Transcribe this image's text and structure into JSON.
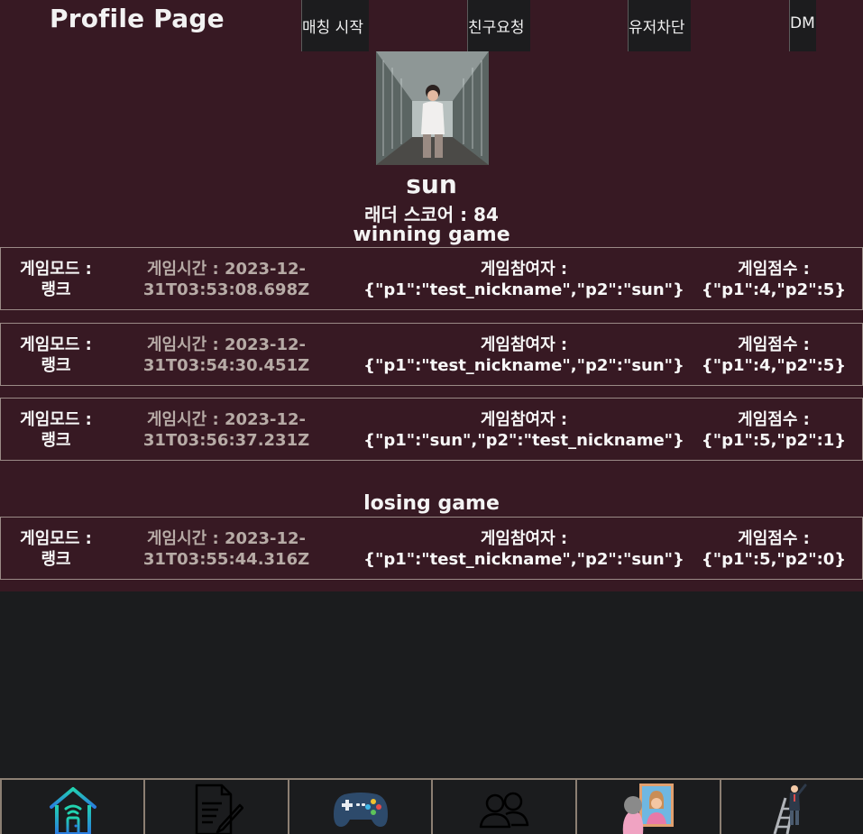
{
  "header": {
    "title": "Profile Page",
    "buttons": {
      "match": "매칭 시작",
      "friend": "친구요청",
      "block": "유저차단",
      "dm": "DM"
    }
  },
  "profile": {
    "username": "sun",
    "ladder_score": "래더 스코어 : 84"
  },
  "winning": {
    "heading": "winning game",
    "games": [
      {
        "mode_label": "게임모드 :",
        "mode": "랭크",
        "time": "게임시간 : 2023-12-31T03:53:08.698Z",
        "players_label": "게임참여자 :",
        "players": "{\"p1\":\"test_nickname\",\"p2\":\"sun\"}",
        "score_label": "게임점수 :",
        "score": "{\"p1\":4,\"p2\":5}"
      },
      {
        "mode_label": "게임모드 :",
        "mode": "랭크",
        "time": "게임시간 : 2023-12-31T03:54:30.451Z",
        "players_label": "게임참여자 :",
        "players": "{\"p1\":\"test_nickname\",\"p2\":\"sun\"}",
        "score_label": "게임점수 :",
        "score": "{\"p1\":4,\"p2\":5}"
      },
      {
        "mode_label": "게임모드 :",
        "mode": "랭크",
        "time": "게임시간 : 2023-12-31T03:56:37.231Z",
        "players_label": "게임참여자 :",
        "players": "{\"p1\":\"sun\",\"p2\":\"test_nickname\"}",
        "score_label": "게임점수 :",
        "score": "{\"p1\":5,\"p2\":1}"
      }
    ]
  },
  "losing": {
    "heading": "losing game",
    "games": [
      {
        "mode_label": "게임모드 :",
        "mode": "랭크",
        "time": "게임시간 : 2023-12-31T03:55:44.316Z",
        "players_label": "게임참여자 :",
        "players": "{\"p1\":\"test_nickname\",\"p2\":\"sun\"}",
        "score_label": "게임점수 :",
        "score": "{\"p1\":5,\"p2\":0}"
      }
    ]
  },
  "bottom_nav": [
    "home-icon",
    "document-icon",
    "gamepad-icon",
    "friends-icon",
    "profile-portrait-icon",
    "ladder-climber-icon"
  ],
  "colors": {
    "profile_bg": "#371923",
    "page_bg": "#1b1c1e",
    "button_bg": "#1c1c1e",
    "row_border": "#9a8a86",
    "time_text": "#b7aba6",
    "nav_border": "#8c7f73"
  }
}
